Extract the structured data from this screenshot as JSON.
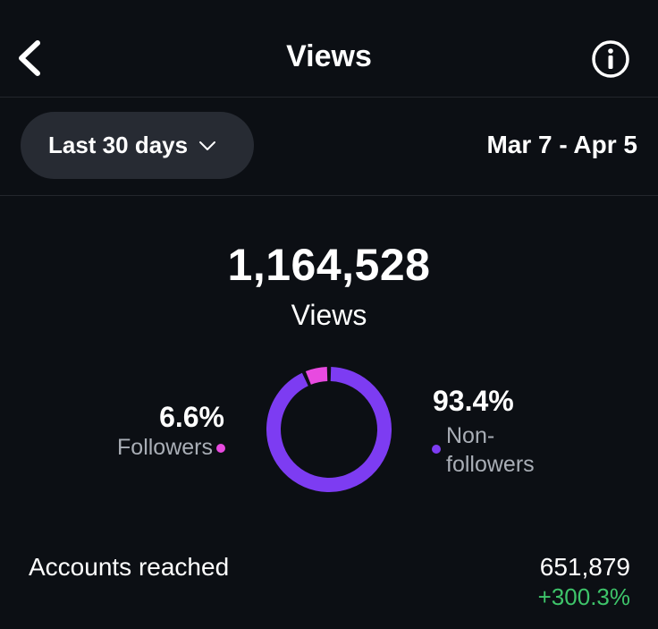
{
  "header": {
    "title": "Views"
  },
  "filter": {
    "range_label": "Last 30 days",
    "date_range": "Mar 7 - Apr 5"
  },
  "summary": {
    "total_views": "1,164,528",
    "total_label": "Views"
  },
  "breakdown": {
    "followers": {
      "percent": "6.6%",
      "label": "Followers",
      "fraction": 0.066
    },
    "non_followers": {
      "percent": "93.4%",
      "label": "Non-followers",
      "label_line1": "Non-",
      "label_line2": "followers",
      "fraction": 0.934
    }
  },
  "accounts_reached": {
    "label": "Accounts reached",
    "value": "651,879",
    "change": "+300.3%"
  },
  "colors": {
    "background": "#0c0f14",
    "pill": "#272b33",
    "followers": "#e84ae0",
    "non_followers": "#7d3cf2",
    "positive": "#3ec46a",
    "muted_text": "#a9aeb6"
  },
  "icons": {
    "back": "chevron-left-icon",
    "info": "info-icon",
    "dropdown": "chevron-down-icon"
  }
}
